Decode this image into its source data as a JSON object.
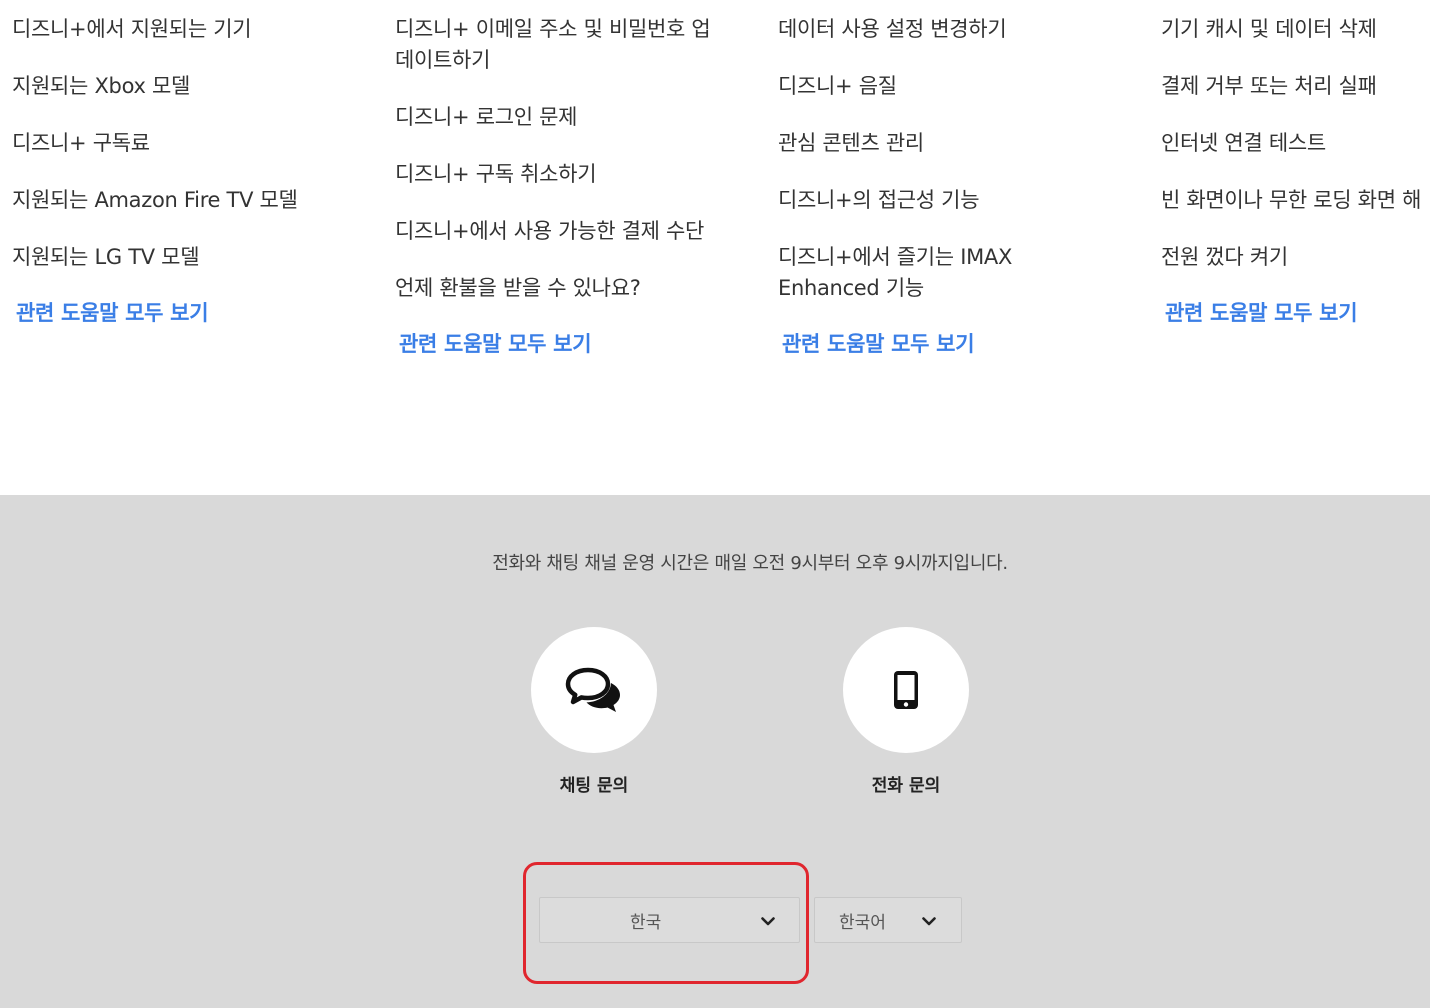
{
  "columns": [
    {
      "items": [
        "디즈니+에서 지원되는 기기",
        "지원되는 Xbox 모델",
        "디즈니+ 구독료",
        "지원되는 Amazon Fire TV 모델",
        "지원되는 LG TV 모델"
      ],
      "see_all": "관련 도움말 모두 보기"
    },
    {
      "items": [
        "디즈니+ 이메일 주소 및 비밀번호 업데이트하기",
        "디즈니+ 로그인 문제",
        "디즈니+ 구독 취소하기",
        "디즈니+에서 사용 가능한 결제 수단",
        "언제 환불을 받을 수 있나요?"
      ],
      "see_all": "관련 도움말 모두 보기"
    },
    {
      "items": [
        "데이터 사용 설정 변경하기",
        "디즈니+ 음질",
        "관심 콘텐츠 관리",
        "디즈니+의 접근성 기능",
        "디즈니+에서 즐기는 IMAX Enhanced 기능"
      ],
      "see_all": "관련 도움말 모두 보기"
    },
    {
      "items": [
        "기기 캐시 및 데이터 삭제",
        "결제 거부 또는 처리 실패",
        "인터넷 연결 테스트",
        "빈 화면이나 무한 로딩 화면 해",
        "전원 껐다 켜기"
      ],
      "see_all": "관련 도움말 모두 보기"
    }
  ],
  "footer": {
    "hours_text": "전화와 채팅 채널 운영 시간은 매일 오전 9시부터 오후 9시까지입니다.",
    "contacts": [
      {
        "label": "채팅 문의",
        "icon": "chat-bubbles-icon"
      },
      {
        "label": "전화 문의",
        "icon": "mobile-phone-icon"
      }
    ],
    "country_select": {
      "value": "한국"
    },
    "language_select": {
      "value": "한국어"
    }
  },
  "colors": {
    "link": "#3a7ee6",
    "footer_bg": "#d9d9d9",
    "highlight": "#e0262e"
  }
}
